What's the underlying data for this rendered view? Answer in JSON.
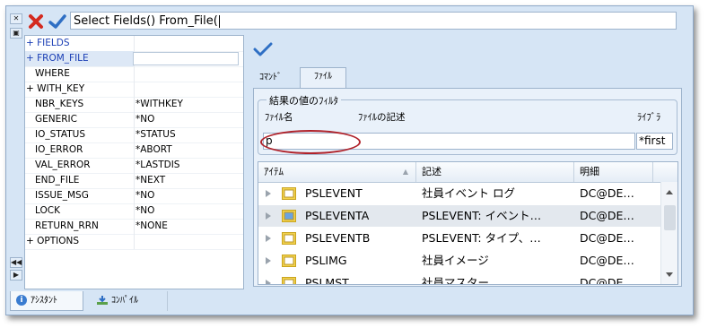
{
  "command": {
    "text": "Select Fields() From_File("
  },
  "toolbar": {
    "cancel_icon": "red-x-icon",
    "accept_icon": "checkmark-icon"
  },
  "properties": [
    {
      "key": "+ FIELDS",
      "value": "",
      "style": "blue"
    },
    {
      "key": "+ FROM_FILE",
      "value": "",
      "style": "blue-sel"
    },
    {
      "key": "WHERE",
      "value": "",
      "style": "plain"
    },
    {
      "key": "+ WITH_KEY",
      "value": "",
      "style": "group"
    },
    {
      "key": "NBR_KEYS",
      "value": "*WITHKEY",
      "style": "plain"
    },
    {
      "key": "GENERIC",
      "value": "*NO",
      "style": "plain"
    },
    {
      "key": "IO_STATUS",
      "value": "*STATUS",
      "style": "plain"
    },
    {
      "key": "IO_ERROR",
      "value": "*ABORT",
      "style": "plain"
    },
    {
      "key": "VAL_ERROR",
      "value": "*LASTDIS",
      "style": "plain"
    },
    {
      "key": "END_FILE",
      "value": "*NEXT",
      "style": "plain"
    },
    {
      "key": "ISSUE_MSG",
      "value": "*NO",
      "style": "plain"
    },
    {
      "key": "LOCK",
      "value": "*NO",
      "style": "plain"
    },
    {
      "key": "RETURN_RRN",
      "value": "*NONE",
      "style": "plain"
    },
    {
      "key": "+ OPTIONS",
      "value": "",
      "style": "group"
    }
  ],
  "tabs": {
    "command": "ｺﾏﾝﾄﾞ",
    "file": "ﾌｧｲﾙ"
  },
  "filter": {
    "legend": "結果の値のﾌｨﾙﾀ",
    "file_name_label": "ﾌｧｲﾙ名",
    "file_desc_label": "ﾌｧｲﾙの記述",
    "library_label": "ﾗｲﾌﾞﾗ",
    "file_name_value": "p",
    "library_value": "*first"
  },
  "grid": {
    "headers": [
      "ｱｲﾃﾑ",
      "記述",
      "明細"
    ],
    "rows": [
      {
        "item": "PSLEVENT",
        "desc": "社員イベント ログ",
        "detail": "DC@DE…",
        "selected": false
      },
      {
        "item": "PSLEVENTA",
        "desc": "PSLEVENT: イベント…",
        "detail": "DC@DE…",
        "selected": true
      },
      {
        "item": "PSLEVENTB",
        "desc": "PSLEVENT: タイプ、…",
        "detail": "DC@DE…",
        "selected": false
      },
      {
        "item": "PSLIMG",
        "desc": "社員イメージ",
        "detail": "DC@DE…",
        "selected": false
      },
      {
        "item": "PSLMST",
        "desc": "社員マスター",
        "detail": "DC@DE…",
        "selected": false
      }
    ]
  },
  "bottom_tabs": {
    "assistant": "ｱｼｽﾀﾝﾄ",
    "compile": "ｺﾝﾊﾟｲﾙ"
  },
  "colors": {
    "accent": "#2f6fc4",
    "cancel": "#d42a1f",
    "ring": "#b0222a"
  }
}
